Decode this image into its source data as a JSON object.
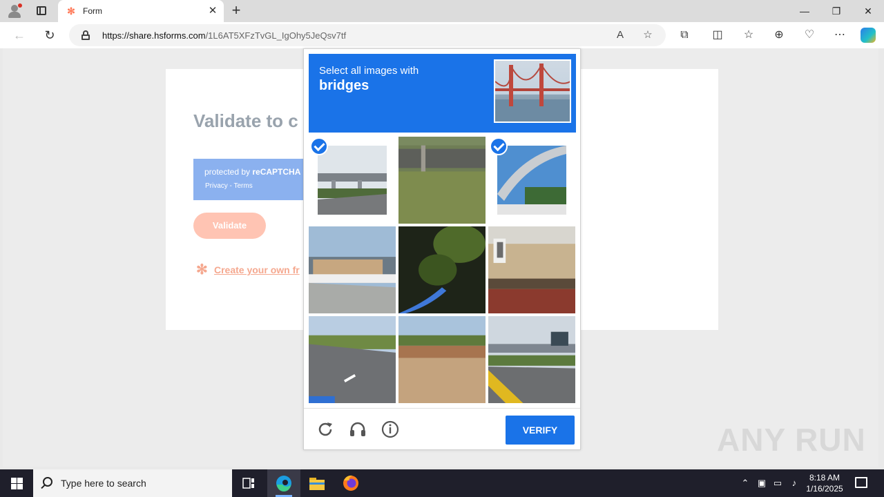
{
  "browser": {
    "tab_title": "Form",
    "url_host": "https://share.hsforms.com",
    "url_path": "/1L6AT5XFzTvGL_IgOhy5JeQsv7tf"
  },
  "form": {
    "title": "Validate to c",
    "recaptcha_protected": "protected by ",
    "recaptcha_brand": "reCAPTCHA",
    "recaptcha_links": "Privacy - Terms",
    "validate_label": "Validate",
    "create_link": "Create your own fr"
  },
  "challenge": {
    "instruction": "Select all images with",
    "target": "bridges",
    "verify_label": "VERIFY",
    "tiles": [
      {
        "scene": "highway-overpass",
        "selected": true
      },
      {
        "scene": "grass-pole-truck",
        "selected": false
      },
      {
        "scene": "flyover-ramp",
        "selected": true
      },
      {
        "scene": "truck-barrier",
        "selected": false
      },
      {
        "scene": "tree-leaves",
        "selected": false
      },
      {
        "scene": "building-wall",
        "selected": false
      },
      {
        "scene": "road-lanes",
        "selected": false
      },
      {
        "scene": "dirt-lot",
        "selected": false
      },
      {
        "scene": "road-overpass-sign",
        "selected": false
      }
    ]
  },
  "watermark": "ANY RUN",
  "taskbar": {
    "search_placeholder": "Type here to search",
    "time": "8:18 AM",
    "date": "1/16/2025"
  },
  "colors": {
    "recaptcha_blue": "#1a73e8",
    "hubspot_orange": "#ff7a59"
  }
}
